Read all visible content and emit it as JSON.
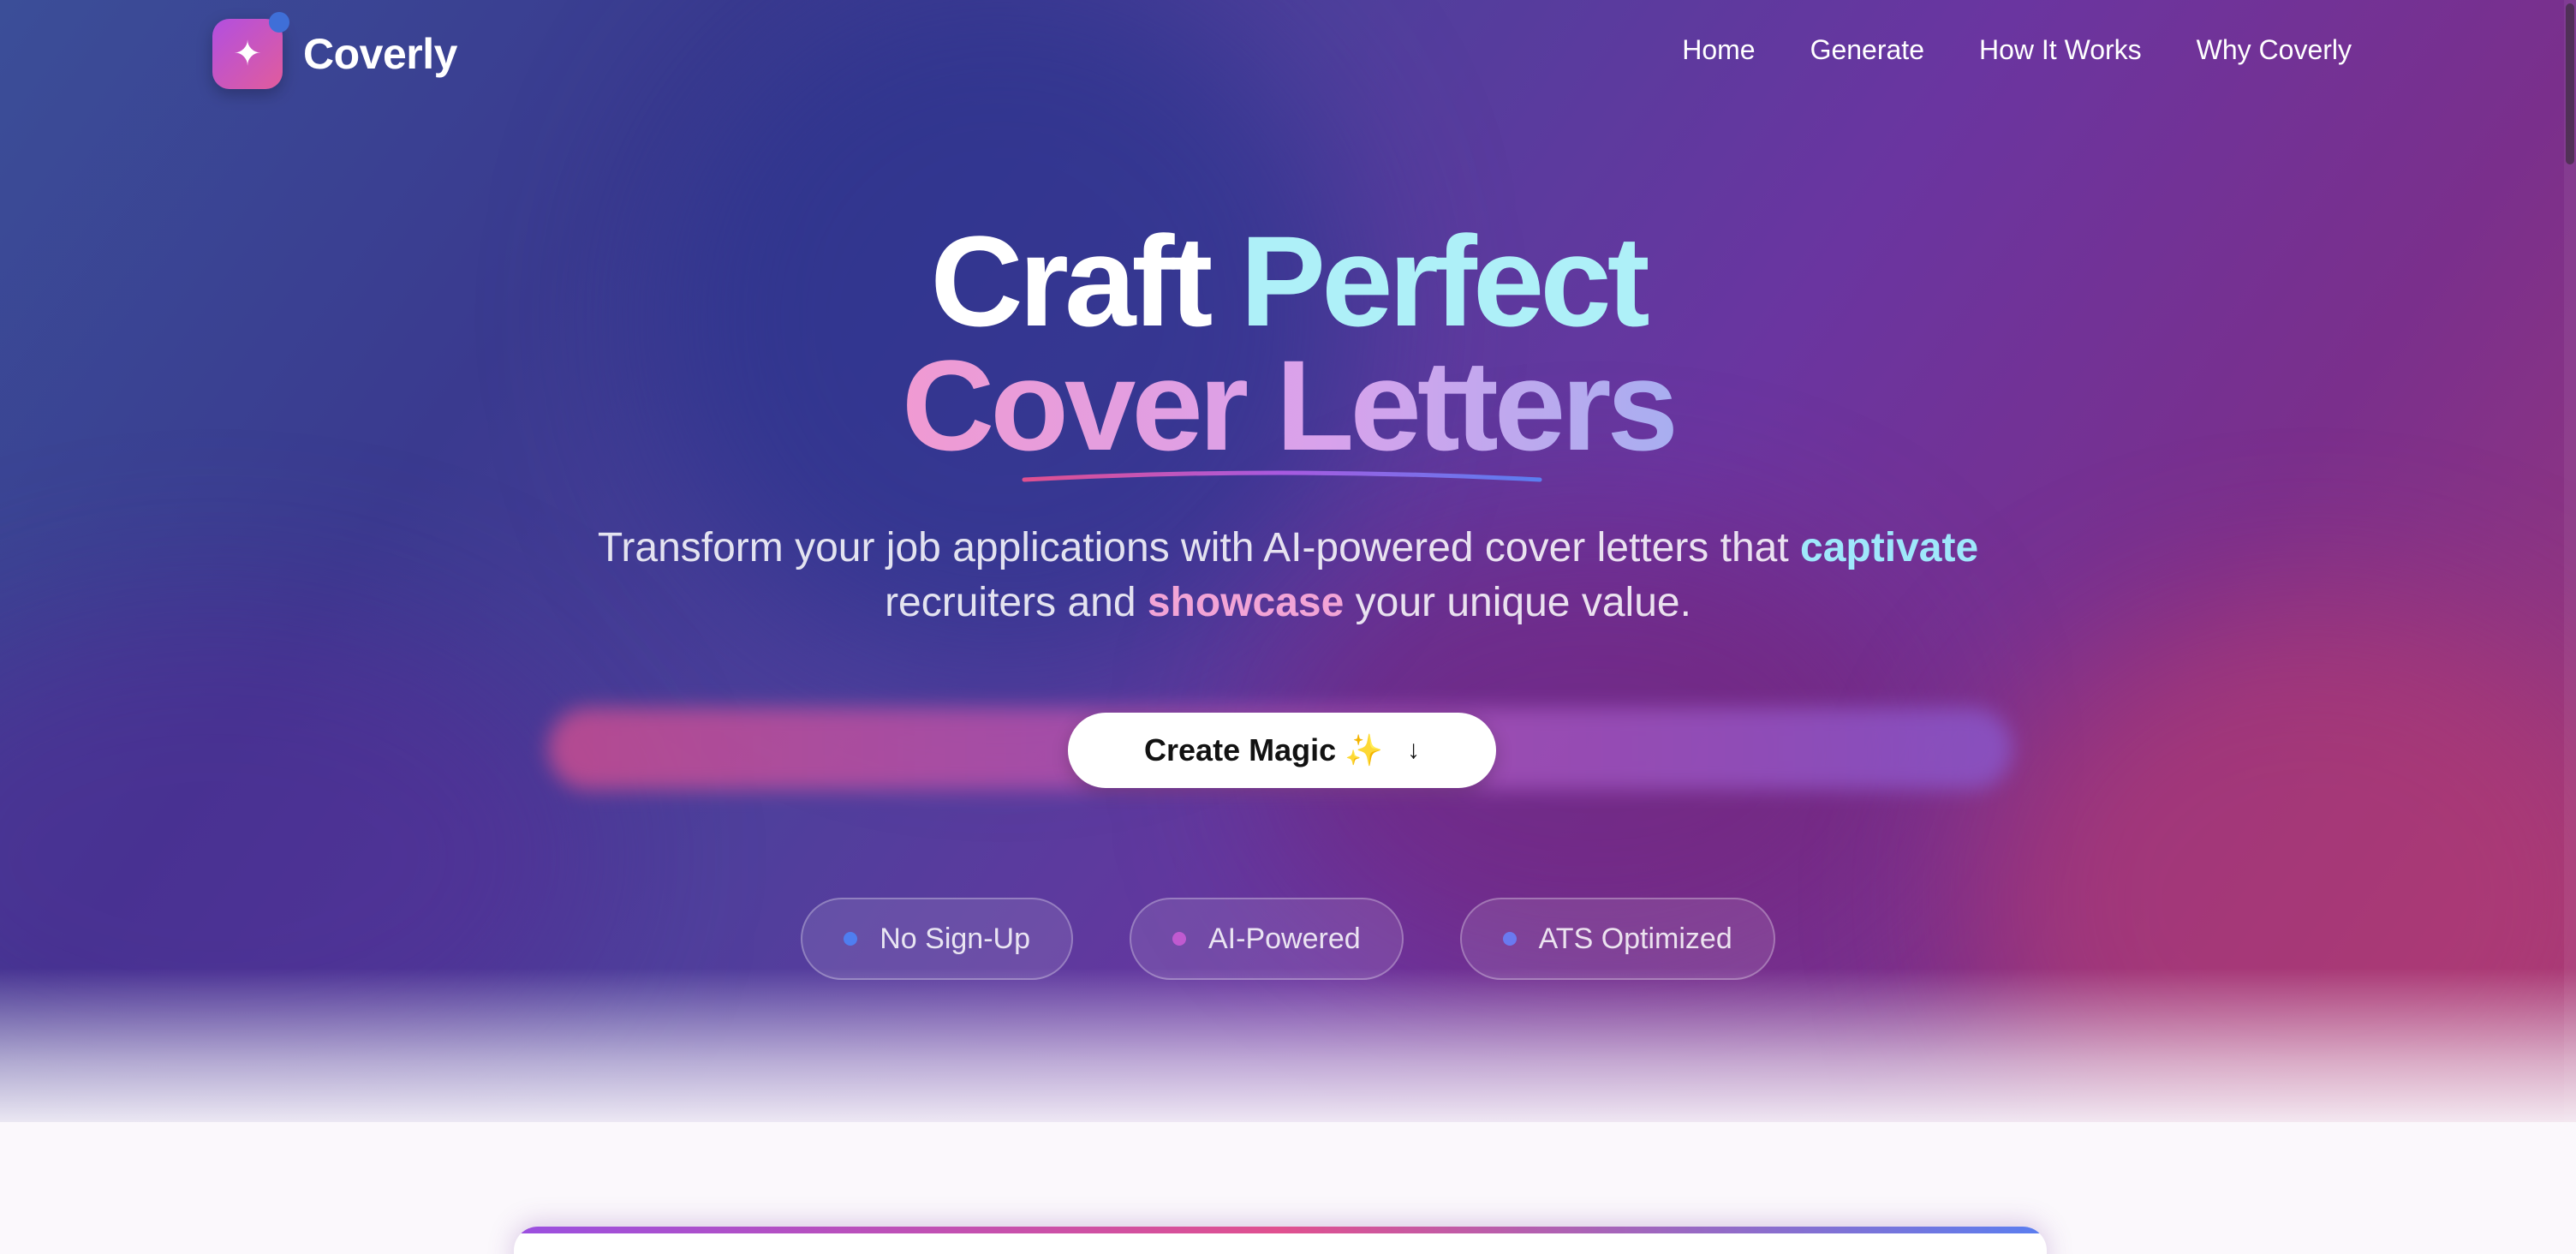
{
  "brand": {
    "name": "Coverly",
    "logo_icon": "sparkle-icon"
  },
  "nav": {
    "links": [
      "Home",
      "Generate",
      "How It Works",
      "Why Coverly"
    ]
  },
  "hero": {
    "headline_line1_a": "Craft",
    "headline_line1_b": "Perfect",
    "headline_line2": "Cover Letters",
    "subtitle_part1": "Transform your job applications with AI-powered cover letters that ",
    "subtitle_highlight1": "captivate",
    "subtitle_part2": "recruiters and ",
    "subtitle_highlight2": "showcase",
    "subtitle_part3": " your unique value.",
    "cta_label": "Create Magic ✨",
    "cta_icon": "arrow-down-icon"
  },
  "features": [
    {
      "label": "No Sign-Up",
      "dot_color": "#4f7ef0"
    },
    {
      "label": "AI-Powered",
      "dot_color": "#c05ad0"
    },
    {
      "label": "ATS Optimized",
      "dot_color": "#6a7af0"
    }
  ],
  "colors": {
    "accent_cyan": "#9fe8fb",
    "accent_pink": "#f2a4d6",
    "brand_gradient_start": "#b24fe0",
    "brand_gradient_end": "#e15c9c"
  }
}
